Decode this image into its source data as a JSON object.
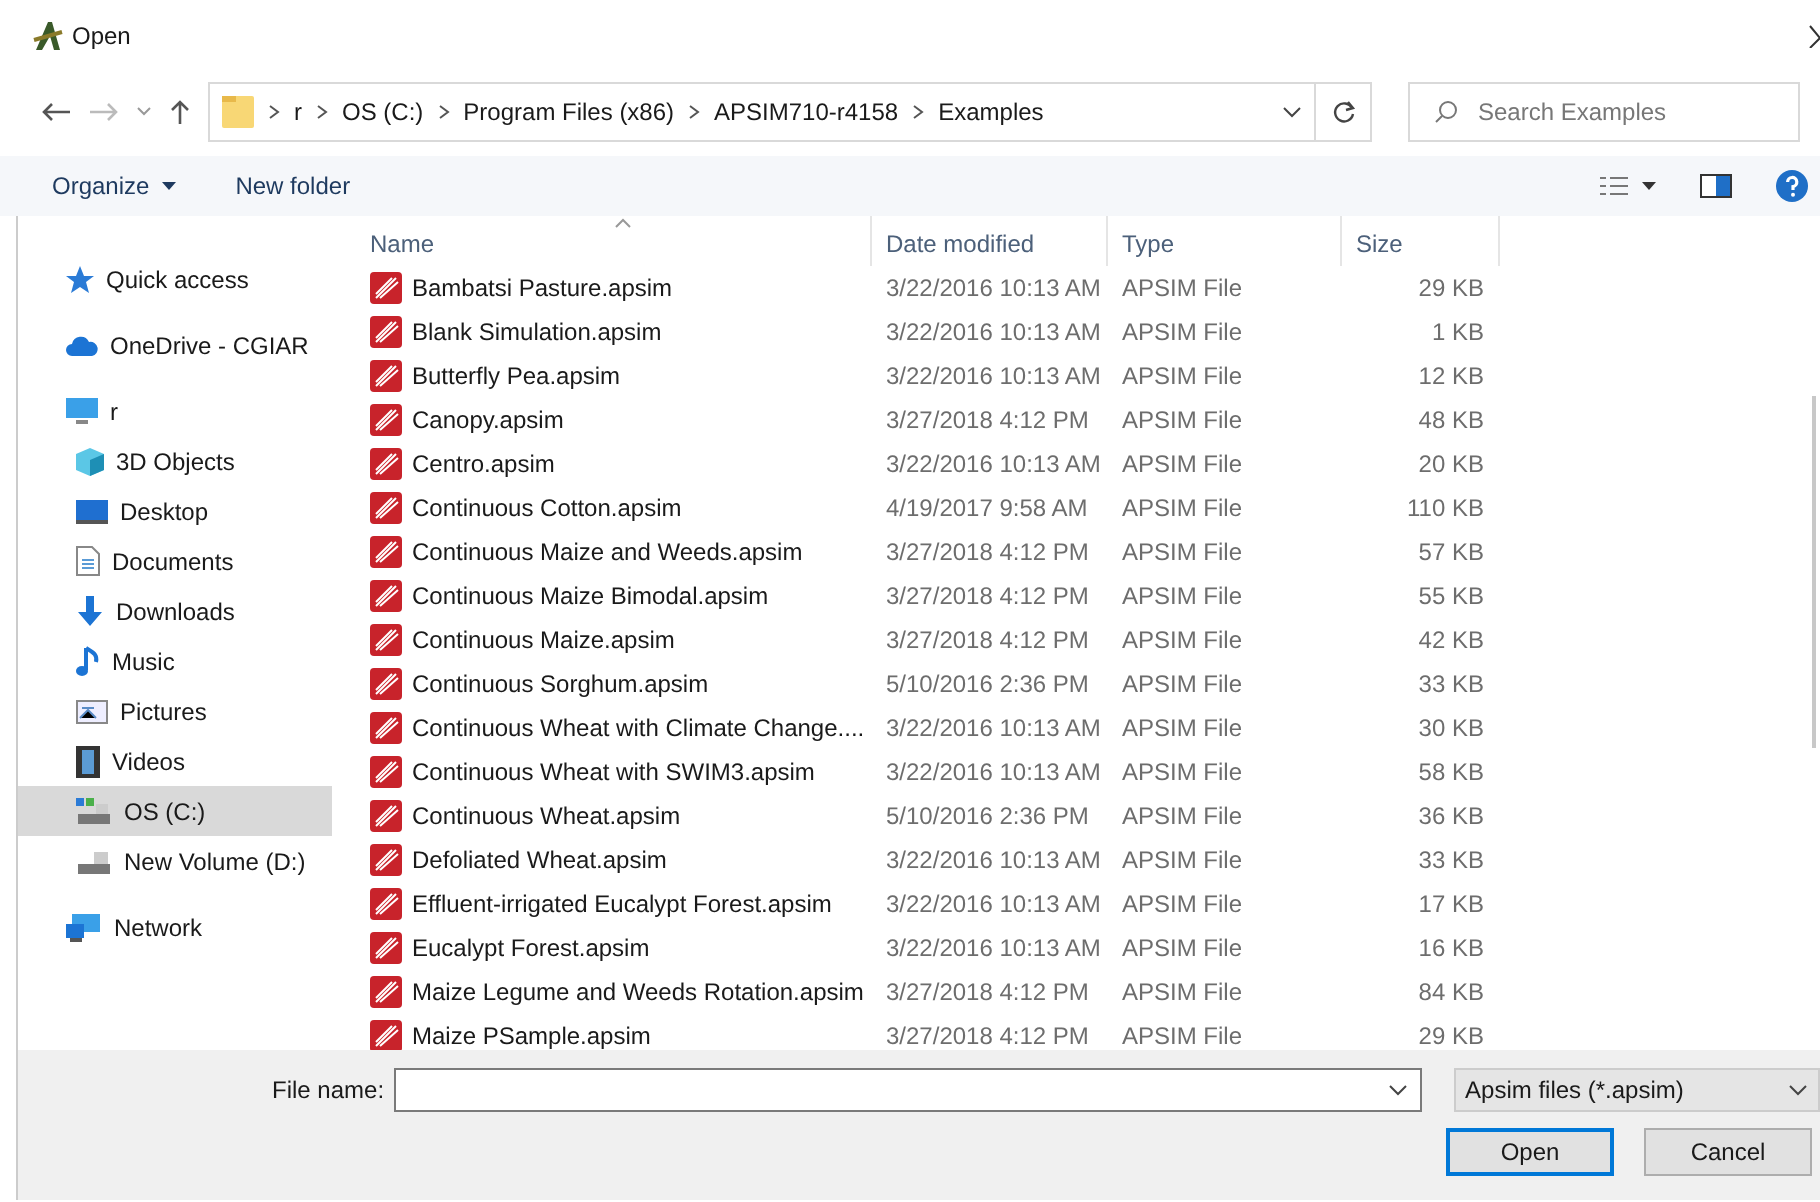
{
  "window": {
    "title": "Open"
  },
  "address": {
    "crumbs": [
      "r",
      "OS (C:)",
      "Program Files (x86)",
      "APSIM710-r4158",
      "Examples"
    ]
  },
  "search": {
    "placeholder": "Search Examples"
  },
  "toolbar": {
    "organize": "Organize",
    "new_folder": "New folder"
  },
  "sidebar": {
    "items": [
      {
        "label": "Quick access",
        "selected": false
      },
      {
        "label": "OneDrive - CGIAR",
        "selected": false
      },
      {
        "label": "r",
        "selected": false,
        "children": [
          {
            "label": "3D Objects",
            "selected": false
          },
          {
            "label": "Desktop",
            "selected": false
          },
          {
            "label": "Documents",
            "selected": false
          },
          {
            "label": "Downloads",
            "selected": false
          },
          {
            "label": "Music",
            "selected": false
          },
          {
            "label": "Pictures",
            "selected": false
          },
          {
            "label": "Videos",
            "selected": false
          },
          {
            "label": "OS (C:)",
            "selected": true
          },
          {
            "label": "New Volume (D:)",
            "selected": false
          }
        ]
      },
      {
        "label": "Network",
        "selected": false
      }
    ]
  },
  "table": {
    "columns": [
      {
        "label": "Name",
        "sorted": true
      },
      {
        "label": "Date modified",
        "sorted": false
      },
      {
        "label": "Type",
        "sorted": false
      },
      {
        "label": "Size",
        "sorted": false
      }
    ],
    "rows": [
      [
        "Bambatsi Pasture.apsim",
        "3/22/2016 10:13 AM",
        "APSIM File",
        "29 KB"
      ],
      [
        "Blank Simulation.apsim",
        "3/22/2016 10:13 AM",
        "APSIM File",
        "1 KB"
      ],
      [
        "Butterfly Pea.apsim",
        "3/22/2016 10:13 AM",
        "APSIM File",
        "12 KB"
      ],
      [
        "Canopy.apsim",
        "3/27/2018 4:12 PM",
        "APSIM File",
        "48 KB"
      ],
      [
        "Centro.apsim",
        "3/22/2016 10:13 AM",
        "APSIM File",
        "20 KB"
      ],
      [
        "Continuous Cotton.apsim",
        "4/19/2017 9:58 AM",
        "APSIM File",
        "110 KB"
      ],
      [
        "Continuous Maize and Weeds.apsim",
        "3/27/2018 4:12 PM",
        "APSIM File",
        "57 KB"
      ],
      [
        "Continuous Maize Bimodal.apsim",
        "3/27/2018 4:12 PM",
        "APSIM File",
        "55 KB"
      ],
      [
        "Continuous Maize.apsim",
        "3/27/2018 4:12 PM",
        "APSIM File",
        "42 KB"
      ],
      [
        "Continuous Sorghum.apsim",
        "5/10/2016 2:36 PM",
        "APSIM File",
        "33 KB"
      ],
      [
        "Continuous Wheat with Climate Change....",
        "3/22/2016 10:13 AM",
        "APSIM File",
        "30 KB"
      ],
      [
        "Continuous Wheat with SWIM3.apsim",
        "3/22/2016 10:13 AM",
        "APSIM File",
        "58 KB"
      ],
      [
        "Continuous Wheat.apsim",
        "5/10/2016 2:36 PM",
        "APSIM File",
        "36 KB"
      ],
      [
        "Defoliated Wheat.apsim",
        "3/22/2016 10:13 AM",
        "APSIM File",
        "33 KB"
      ],
      [
        "Effluent-irrigated Eucalypt Forest.apsim",
        "3/22/2016 10:13 AM",
        "APSIM File",
        "17 KB"
      ],
      [
        "Eucalypt Forest.apsim",
        "3/22/2016 10:13 AM",
        "APSIM File",
        "16 KB"
      ],
      [
        "Maize Legume and Weeds Rotation.apsim",
        "3/27/2018 4:12 PM",
        "APSIM File",
        "84 KB"
      ],
      [
        "Maize PSample.apsim",
        "3/27/2018 4:12 PM",
        "APSIM File",
        "29 KB"
      ]
    ]
  },
  "footer": {
    "file_name_label": "File name:",
    "filter": "Apsim files (*.apsim)",
    "buttons": [
      {
        "label": "Open",
        "default": true
      },
      {
        "label": "Cancel",
        "default": false
      }
    ]
  }
}
